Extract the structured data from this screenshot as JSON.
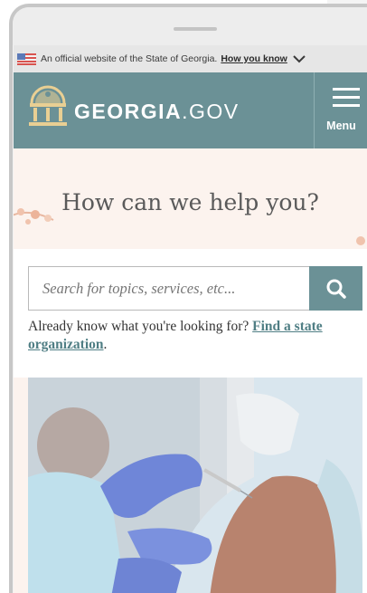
{
  "banner": {
    "official_text": "An official website of the State of Georgia.",
    "how_you_know": "How you know"
  },
  "header": {
    "brand_bold": "GEORGIA",
    "brand_light": ".GOV",
    "menu_label": "Menu"
  },
  "hero": {
    "title": "How can we help you?"
  },
  "search": {
    "placeholder": "Search for topics, services, etc...",
    "prompt_text": "Already know what you're looking for?",
    "link_text": "Find a state organization",
    "trailing": "."
  },
  "colors": {
    "header_teal": "#6b9196",
    "hero_bg": "#fcf3ee",
    "link": "#4f7e84"
  },
  "icons": {
    "flag": "us-flag-icon",
    "chevron": "chevron-down-icon",
    "seal": "georgia-seal-icon",
    "menu": "hamburger-icon",
    "search": "search-icon"
  }
}
